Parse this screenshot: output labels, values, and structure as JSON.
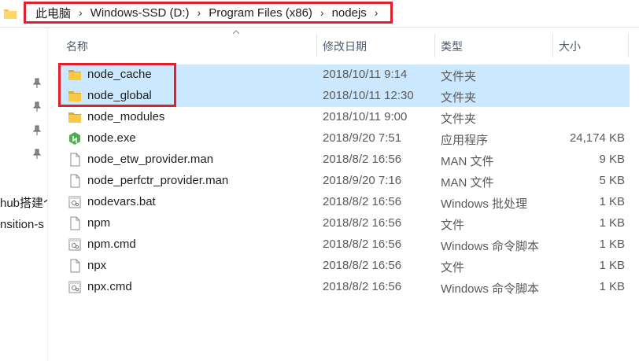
{
  "address": {
    "crumbs": [
      "此电脑",
      "Windows-SSD (D:)",
      "Program Files (x86)",
      "nodejs"
    ],
    "separator": "›"
  },
  "nav": {
    "labels": [
      "hub搭建个",
      "nsition-s"
    ]
  },
  "columns": {
    "name": "名称",
    "date": "修改日期",
    "type": "类型",
    "size": "大小"
  },
  "files": [
    {
      "name": "node_cache",
      "date": "2018/10/11 9:14",
      "type": "文件夹",
      "size": "",
      "icon": "folder-icon",
      "selected": true
    },
    {
      "name": "node_global",
      "date": "2018/10/11 12:30",
      "type": "文件夹",
      "size": "",
      "icon": "folder-icon",
      "selected": true
    },
    {
      "name": "node_modules",
      "date": "2018/10/11 9:00",
      "type": "文件夹",
      "size": "",
      "icon": "folder-icon",
      "selected": false
    },
    {
      "name": "node.exe",
      "date": "2018/9/20 7:51",
      "type": "应用程序",
      "size": "24,174 KB",
      "icon": "nodejs-app-icon",
      "selected": false
    },
    {
      "name": "node_etw_provider.man",
      "date": "2018/8/2 16:56",
      "type": "MAN 文件",
      "size": "9 KB",
      "icon": "file-icon",
      "selected": false
    },
    {
      "name": "node_perfctr_provider.man",
      "date": "2018/9/20 7:16",
      "type": "MAN 文件",
      "size": "5 KB",
      "icon": "file-icon",
      "selected": false
    },
    {
      "name": "nodevars.bat",
      "date": "2018/8/2 16:56",
      "type": "Windows 批处理",
      "size": "1 KB",
      "icon": "script-file-icon",
      "selected": false
    },
    {
      "name": "npm",
      "date": "2018/8/2 16:56",
      "type": "文件",
      "size": "1 KB",
      "icon": "file-icon",
      "selected": false
    },
    {
      "name": "npm.cmd",
      "date": "2018/8/2 16:56",
      "type": "Windows 命令脚本",
      "size": "1 KB",
      "icon": "script-file-icon",
      "selected": false
    },
    {
      "name": "npx",
      "date": "2018/8/2 16:56",
      "type": "文件",
      "size": "1 KB",
      "icon": "file-icon",
      "selected": false
    },
    {
      "name": "npx.cmd",
      "date": "2018/8/2 16:56",
      "type": "Windows 命令脚本",
      "size": "1 KB",
      "icon": "script-file-icon",
      "selected": false
    }
  ],
  "colors": {
    "selection": "#cce8ff",
    "highlight_box": "#e0202a",
    "folder": "#f5c242"
  }
}
